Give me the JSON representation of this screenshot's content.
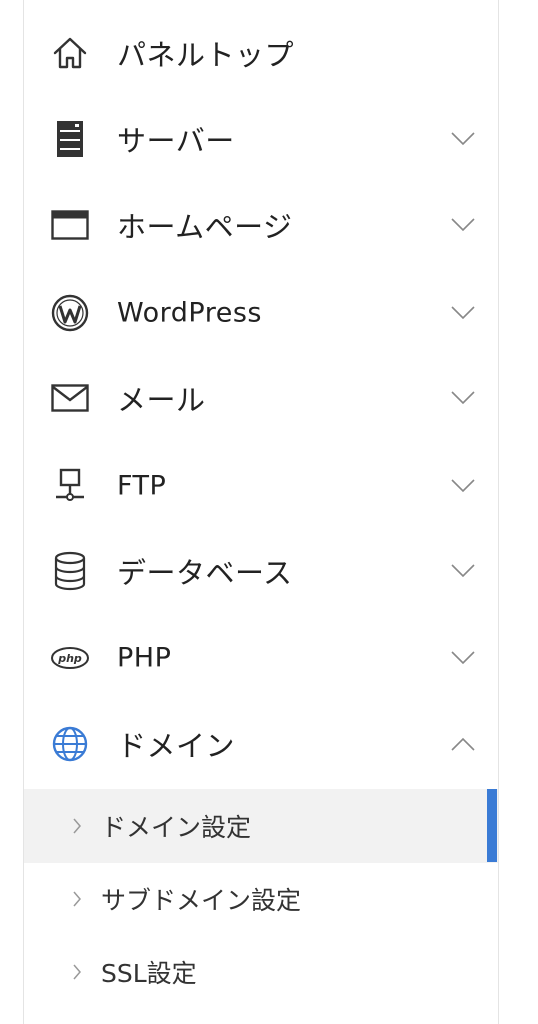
{
  "menu": {
    "items": [
      {
        "label": "パネルトップ",
        "icon": "home-icon"
      },
      {
        "label": "サーバー",
        "icon": "server-icon",
        "expanded": false
      },
      {
        "label": "ホームページ",
        "icon": "browser-window-icon",
        "expanded": false
      },
      {
        "label": "WordPress",
        "icon": "wordpress-icon",
        "expanded": false
      },
      {
        "label": "メール",
        "icon": "mail-icon",
        "expanded": false
      },
      {
        "label": "FTP",
        "icon": "ftp-network-icon",
        "expanded": false
      },
      {
        "label": "データベース",
        "icon": "database-icon",
        "expanded": false
      },
      {
        "label": "PHP",
        "icon": "php-icon",
        "expanded": false
      },
      {
        "label": "ドメイン",
        "icon": "globe-icon",
        "expanded": true
      }
    ],
    "domain_submenu": [
      {
        "label": "ドメイン設定",
        "active": true
      },
      {
        "label": "サブドメイン設定",
        "active": false
      },
      {
        "label": "SSL設定",
        "active": false
      }
    ]
  },
  "colors": {
    "accent": "#3a7bd5",
    "globe": "#3a7bd5",
    "active_bg": "#f2f2f2",
    "text": "#222222"
  }
}
